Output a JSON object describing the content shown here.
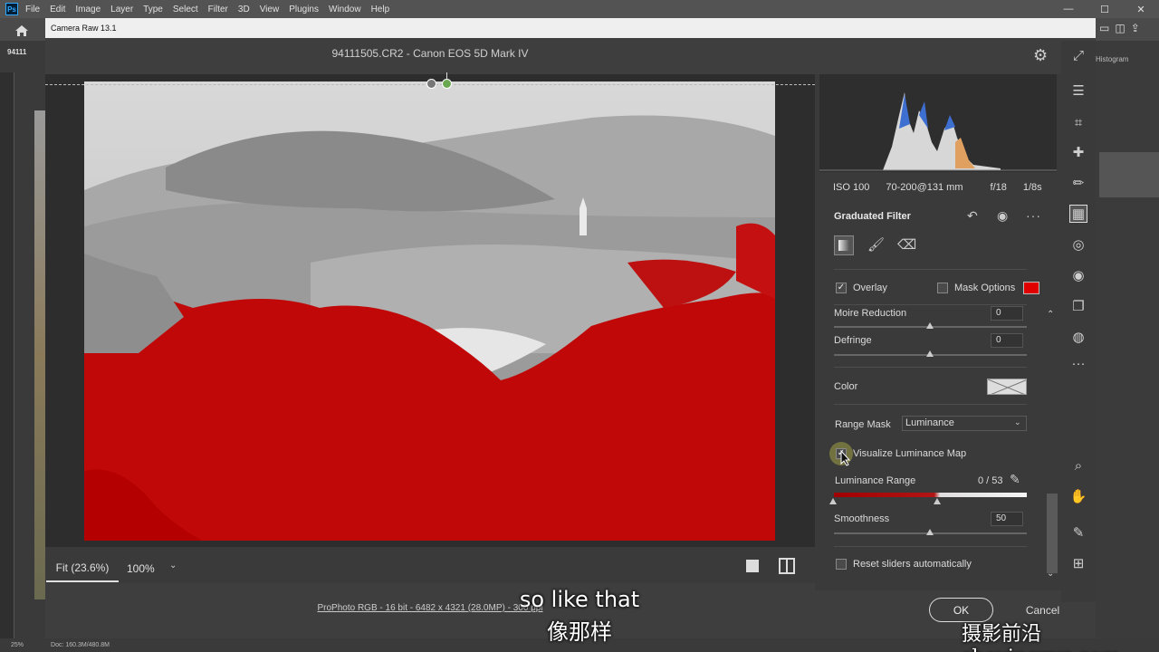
{
  "ps": {
    "logo": "Ps",
    "menu": [
      "File",
      "Edit",
      "Image",
      "Layer",
      "Type",
      "Select",
      "Filter",
      "3D",
      "View",
      "Plugins",
      "Window",
      "Help"
    ],
    "window_controls": [
      "—",
      "☐",
      "✕"
    ],
    "doc_tab": "94111",
    "histogram_label": "Histogram",
    "status_zoom": "25%",
    "status_doc": "Doc: 160.3M/480.8M"
  },
  "camera_raw": {
    "title": "Camera Raw 13.1",
    "filename": "94111505.CR2  -  Canon EOS 5D Mark IV",
    "camera_info": {
      "iso": "ISO 100",
      "lens": "70-200@131 mm",
      "aperture": "f/18",
      "shutter": "1/8s"
    },
    "zoom_fit": "Fit (23.6%)",
    "zoom_value": "100%",
    "workflow": "ProPhoto RGB - 16 bit - 6482 x 4321 (28.0MP) - 300 ppi",
    "ok": "OK",
    "cancel": "Cancel",
    "graduated_filter": {
      "title": "Graduated Filter",
      "overlay_label": "Overlay",
      "overlay_checked": true,
      "mask_options_label": "Mask Options",
      "mask_options_checked": false,
      "overlay_color": "#e00000",
      "moire_label": "Moire Reduction",
      "moire_value": "0",
      "defringe_label": "Defringe",
      "defringe_value": "0",
      "color_label": "Color",
      "range_mask_label": "Range Mask",
      "range_mask_value": "Luminance",
      "visualize_label": "Visualize Luminance Map",
      "visualize_checked": true,
      "lum_range_label": "Luminance Range",
      "lum_range_value": "0 / 53",
      "smoothness_label": "Smoothness",
      "smoothness_value": "50",
      "reset_label": "Reset sliders automatically",
      "reset_checked": false
    }
  },
  "subtitles": {
    "en": "so like that",
    "cn": "像那样"
  },
  "watermark": "摄影前沿 sheyingzyz.com",
  "icons": {
    "home": "home-icon",
    "gear": "gear-icon",
    "expand": "expand-icon"
  }
}
